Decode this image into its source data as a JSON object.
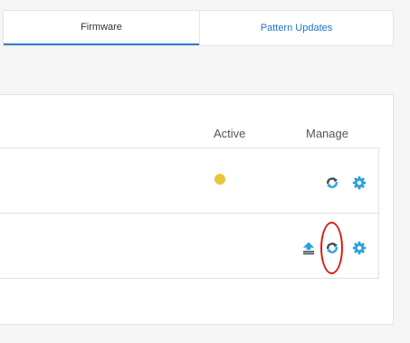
{
  "tabs": [
    {
      "label": "Firmware",
      "selected": true
    },
    {
      "label": "Pattern Updates",
      "selected": false
    }
  ],
  "table": {
    "columns": {
      "active": "Active",
      "manage": "Manage"
    },
    "rows": [
      {
        "active_status_color": "#e9c53a",
        "actions": [
          "sync-icon",
          "gear-icon"
        ]
      },
      {
        "actions": [
          "upload-icon",
          "sync-icon",
          "gear-icon"
        ],
        "highlighted_action": "sync-icon"
      }
    ]
  },
  "colors": {
    "tab_underline": "#2f7fcf",
    "link_blue": "#1f73c6",
    "icon_blue": "#29a3dd",
    "icon_dark": "#3b4b5a",
    "highlight": "#e01818"
  }
}
